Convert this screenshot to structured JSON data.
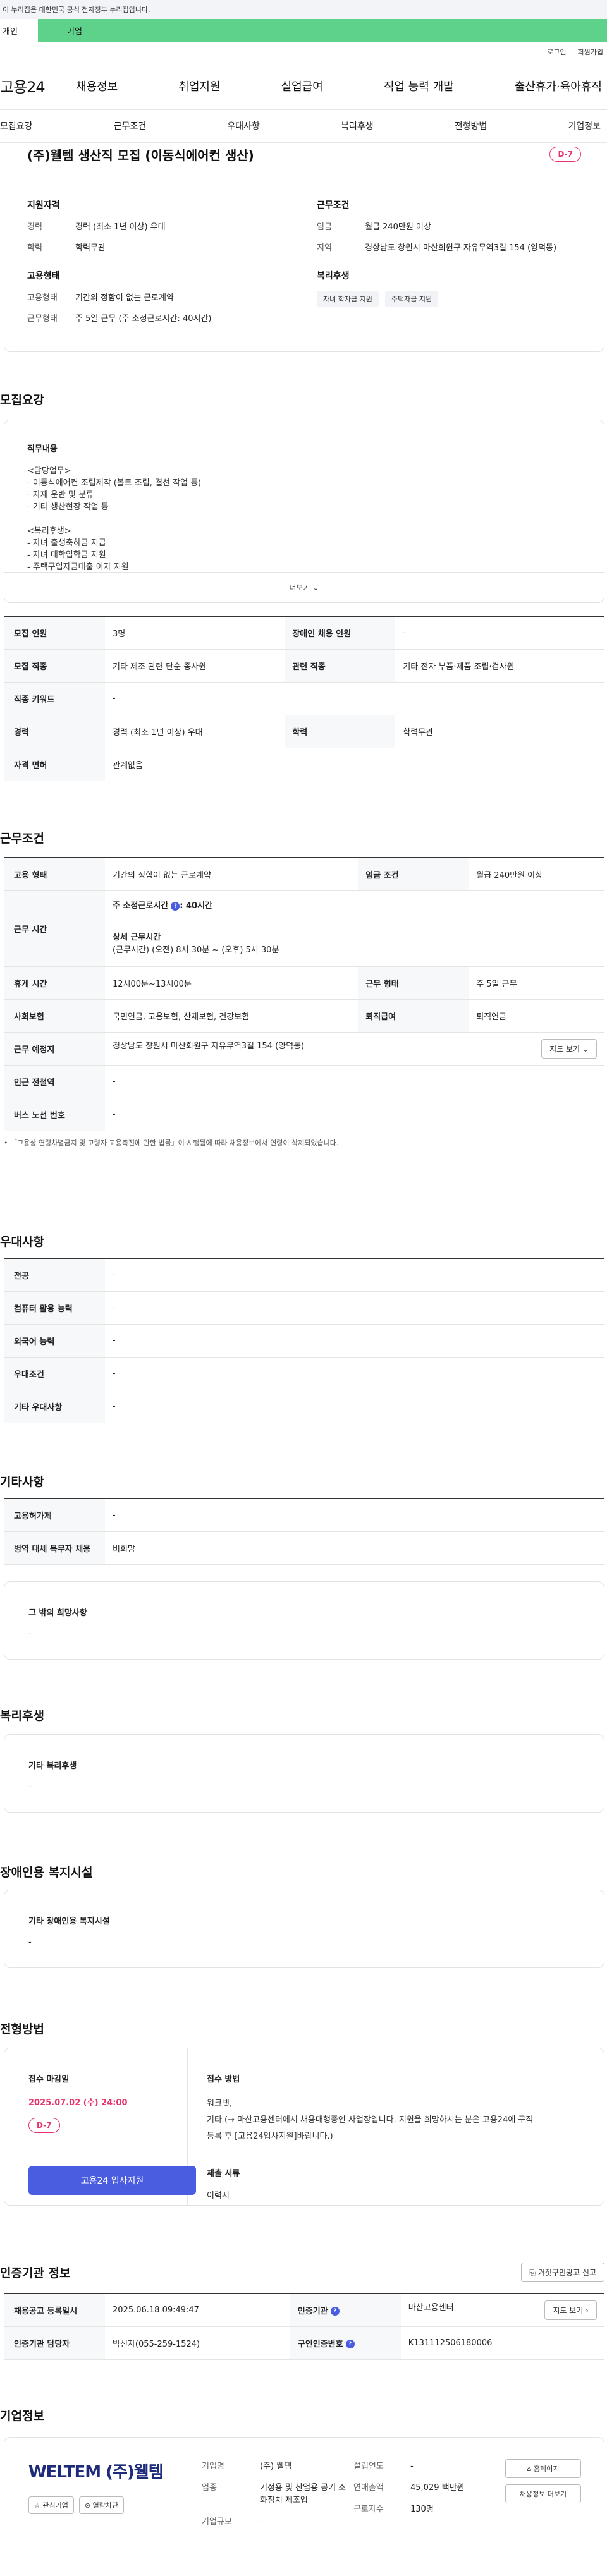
{
  "gov_notice": "이 누리집은 대한민국 공식 전자정부 누리집입니다.",
  "top_tabs": {
    "personal": "개인",
    "company": "기업"
  },
  "util": {
    "login": "로그인",
    "join": "회원가입"
  },
  "logo": "고용24",
  "gnb": [
    "채용정보",
    "취업지원",
    "실업급여",
    "직업 능력 개발",
    "출산휴가·육아휴직"
  ],
  "subnav": [
    "모집요강",
    "근무조건",
    "우대사항",
    "복리후생",
    "전형방법",
    "기업정보"
  ],
  "job": {
    "title": "(주)웰템 생산직 모집 (이동식에어컨 생산)",
    "dday": "D-7"
  },
  "summary": {
    "qual_title": "지원자격",
    "career_k": "경력",
    "career_v": "경력 (최소 1년 이상) 우대",
    "edu_k": "학력",
    "edu_v": "학력무관",
    "cond_title": "근무조건",
    "wage_k": "임금",
    "wage_v": "월급 240만원 이상",
    "region_k": "지역",
    "region_v": "경상남도 창원시 마산회원구 자유무역3길 154 (양덕동)",
    "emp_title": "고용형태",
    "emptype_k": "고용형태",
    "emptype_v": "기간의 정함이 없는 근로계약",
    "worktype_k": "근무형태",
    "worktype_v": "주 5일 근무 (주 소정근로시간: 40시간)",
    "welfare_title": "복리후생",
    "chips": [
      "자녀 학자금 지원",
      "주택자금 지원"
    ]
  },
  "recruit": {
    "heading": "모집요강",
    "duty_title": "직무내용",
    "duty_lines": [
      "<담당업무>",
      "- 이동식에어컨 조립제작 (볼트 조립, 결선 작업 등)",
      "- 자재 운반 및 분류",
      "- 기타 생산현장 작업 등",
      "",
      "<복리후생>",
      "- 자녀 출생축하금 지급",
      "- 자녀 대학입학금 지원",
      "- 주택구입자금대출 이자 지원"
    ],
    "more": "더보기",
    "rows": [
      {
        "k1": "모집 인원",
        "v1": "3명",
        "k2": "장애인 채용 인원",
        "v2": "-"
      },
      {
        "k1": "모집 직종",
        "v1": "기타 제조 관련 단순 종사원",
        "k2": "관련 직종",
        "v2": "기타 전자 부품·제품 조립·검사원"
      },
      {
        "k1": "직종 키워드",
        "v1": "-"
      },
      {
        "k1": "경력",
        "v1": "경력 (최소 1년 이상) 우대",
        "k2": "학력",
        "v2": "학력무관"
      },
      {
        "k1": "자격 면허",
        "v1": "관계없음"
      }
    ]
  },
  "work": {
    "heading": "근무조건",
    "emptype_k": "고용 형태",
    "emptype_v": "기간의 정함이 없는 근로계약",
    "wage_k": "임금 조건",
    "wage_v": "월급 240만원 이상",
    "hours_k": "근무 시간",
    "weekly_label": "주 소정근로시간",
    "weekly_value": ": 40시간",
    "detail_title": "상세 근무시간",
    "detail_value": "(근무시간) (오전) 8시 30분 ~ (오후) 5시 30분",
    "break_k": "휴게 시간",
    "break_v": "12시00분~13시00분",
    "form_k": "근무 형태",
    "form_v": "주 5일 근무",
    "ins_k": "사회보험",
    "ins_v": "국민연금, 고용보험, 산재보험, 건강보험",
    "sev_k": "퇴직급여",
    "sev_v": "퇴직연금",
    "loc_k": "근무 예정지",
    "loc_v": "경상남도 창원시 마산회원구 자유무역3길 154 (양덕동)",
    "map_btn": "지도 보기",
    "subway_k": "인근 전철역",
    "subway_v": "-",
    "bus_k": "버스 노선 번호",
    "bus_v": "-",
    "note": "• 「고용상 연령차별금지 및 고령자 고용촉진에 관한 법률」이 시행됨에 따라 채용정보에서 연령이 삭제되었습니다."
  },
  "pref": {
    "heading": "우대사항",
    "rows": [
      {
        "k": "전공",
        "v": "-"
      },
      {
        "k": "컴퓨터 활용 능력",
        "v": "-"
      },
      {
        "k": "외국어 능력",
        "v": "-"
      },
      {
        "k": "우대조건",
        "v": "-"
      },
      {
        "k": "기타 우대사항",
        "v": "-"
      }
    ]
  },
  "etc": {
    "heading": "기타사항",
    "rows": [
      {
        "k": "고용허가제",
        "v": "-"
      },
      {
        "k": "병역 대체 복무자 채용",
        "v": "비희망"
      }
    ],
    "other_title": "그 밖의 희망사항",
    "other_value": "-"
  },
  "welfare": {
    "heading": "복리후생",
    "title": "기타 복리후생",
    "value": "-"
  },
  "disabled": {
    "heading": "장애인용 복지시설",
    "title": "기타 장애인용 복지시설",
    "value": "-"
  },
  "selection": {
    "heading": "전형방법",
    "deadline_title": "접수 마감일",
    "deadline_value": "2025.07.02 (수) 24:00",
    "dday": "D-7",
    "apply_btn": "고용24 입사지원",
    "method_title": "접수 방법",
    "method_lines": [
      "워크넷,",
      "기타 (→ 마산고용센터에서 채용대행중인 사업장입니다. 지원을 희망하시는 분은 고용24에 구직",
      "등록 후 [고용24입사지원]바랍니다.)"
    ],
    "docs_title": "제출 서류",
    "docs_value": "이력서"
  },
  "cert": {
    "heading": "인증기관 정보",
    "report_btn": "거짓구인광고 신고",
    "reg_k": "채용공고 등록일시",
    "reg_v": "2025.06.18 09:49:47",
    "org_k": "인증기관",
    "org_v": "마산고용센터",
    "map_btn": "지도 보기",
    "mgr_k": "인증기관 담당자",
    "mgr_v": "박선자(055-259-1524)",
    "no_k": "구인인증번호",
    "no_v": "K131112506180006"
  },
  "company": {
    "heading": "기업정보",
    "logo_text": "WELTEM (주)웰템",
    "fav_btn": "관심기업",
    "block_btn": "열람차단",
    "name_k": "기업명",
    "name_v": "(주) 웰템",
    "year_k": "설립연도",
    "year_v": "-",
    "industry_k": "업종",
    "industry_v": "기정용 및 산업용 공기 조화장치 제조업",
    "sales_k": "연매출액",
    "sales_v": "45,029 백만원",
    "emp_k": "근로자수",
    "emp_v": "130명",
    "size_k": "기업규모",
    "size_v": "-",
    "home_btn": "홈페이지",
    "list_btn": "채용정보 더보기"
  }
}
